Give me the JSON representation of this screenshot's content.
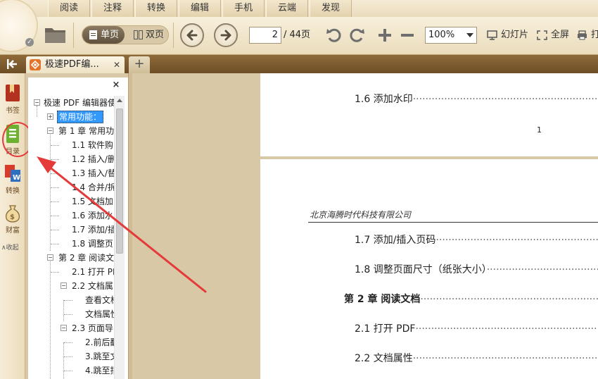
{
  "menu": {
    "tabs": [
      "阅读",
      "注释",
      "转换",
      "编辑",
      "手机",
      "云端",
      "发现"
    ]
  },
  "toolbar": {
    "single_label": "单页",
    "double_label": "双页",
    "page_current": "2",
    "page_total": "/ 44页",
    "zoom": "100%",
    "slideshow_label": "幻灯片",
    "fullscreen_label": "全屏",
    "print_label": "打"
  },
  "tabs": {
    "doc_title": "极速PDF编...",
    "new_tab": "+"
  },
  "rail": {
    "bookmark": "书签",
    "toc": "目录",
    "convert": "转换",
    "wealth": "财富",
    "collapse": "∧收起"
  },
  "toc": {
    "close": "×",
    "items": [
      {
        "text": "极速 PDF 编辑器使"
      },
      {
        "text": "常用功能："
      },
      {
        "text": "第 1 章 常用功"
      },
      {
        "text": "1.1 软件购"
      },
      {
        "text": "1.2 插入/删"
      },
      {
        "text": "1.3 插入/替"
      },
      {
        "text": "1.4 合并/拆"
      },
      {
        "text": "1.5 文档加"
      },
      {
        "text": "1.6 添加水"
      },
      {
        "text": "1.7 添加/插"
      },
      {
        "text": "1.8 调整页"
      },
      {
        "text": "第 2 章 阅读文"
      },
      {
        "text": "2.1 打开 PI"
      },
      {
        "text": "2.2 文档属"
      },
      {
        "text": "查看文档"
      },
      {
        "text": "文档属性"
      },
      {
        "text": "2.3 页面导"
      },
      {
        "text": "2.前后翻"
      },
      {
        "text": "3.跳至文"
      },
      {
        "text": "4.跳至指"
      }
    ]
  },
  "document": {
    "page1_entry": "1.6 添加水印",
    "page1_number": "1",
    "page2_header": "北京海腾时代科技有限公司",
    "page2_entries": [
      {
        "text": "1.7 添加/插入页码",
        "bold": false
      },
      {
        "text": "1.8 调整页面尺寸（纸张大小）",
        "bold": false
      },
      {
        "text": "第 2 章 阅读文档",
        "bold": true
      },
      {
        "text": "2.1 打开 PDF",
        "bold": false
      },
      {
        "text": "2.2 文档属性",
        "bold": false
      }
    ]
  },
  "colors": {
    "accent_brown": "#6e4e26",
    "annotation_red": "#e53a3a",
    "selection_blue": "#3399ff"
  }
}
